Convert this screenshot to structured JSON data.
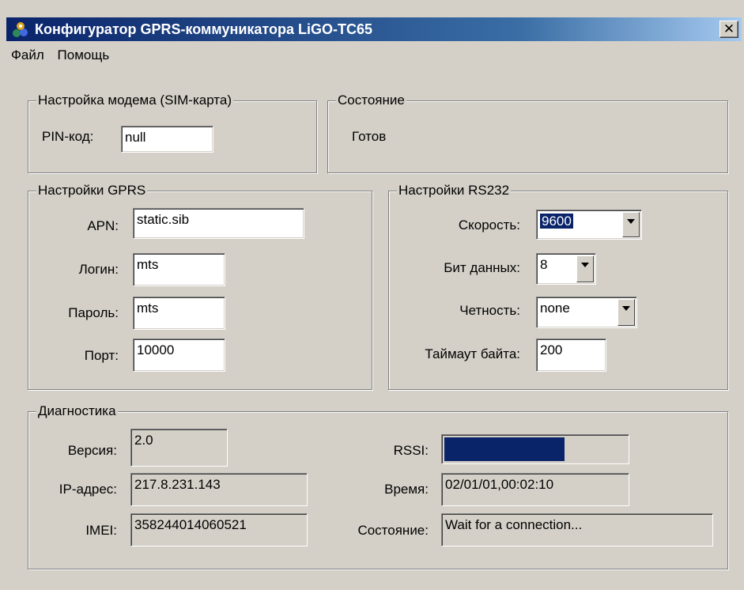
{
  "window": {
    "title": "Конфигуратор GPRS-коммуникатора LiGO-TC65",
    "close_label": "✕"
  },
  "menu": [
    "Файл",
    "Помощь"
  ],
  "modem": {
    "group_label": "Настройка модема (SIM-карта)",
    "pin_label": "PIN-код:",
    "pin_value": "null"
  },
  "status": {
    "group_label": "Состояние",
    "text": "Готов"
  },
  "gprs": {
    "group_label": "Настройки GPRS",
    "apn_label": "APN:",
    "apn_value": "static.sib",
    "login_label": "Логин:",
    "login_value": "mts",
    "password_label": "Пароль:",
    "password_value": "mts",
    "port_label": "Порт:",
    "port_value": "10000"
  },
  "rs232": {
    "group_label": "Настройки RS232",
    "speed_label": "Скорость:",
    "speed_value": "9600",
    "databits_label": "Бит данных:",
    "databits_value": "8",
    "parity_label": "Четность:",
    "parity_value": "none",
    "timeout_label": "Таймаут байта:",
    "timeout_value": "200"
  },
  "diag": {
    "group_label": "Диагностика",
    "version_label": "Версия:",
    "version_value": "2.0",
    "ip_label": "IP-адрес:",
    "ip_value": "217.8.231.143",
    "imei_label": "IMEI:",
    "imei_value": "358244014060521",
    "rssi_label": "RSSI:",
    "rssi_fraction": 0.66,
    "time_label": "Время:",
    "time_value": "02/01/01,00:02:10",
    "state_label": "Состояние:",
    "state_value": "Wait for a connection..."
  },
  "colors": {
    "face": "#d4d0c8",
    "title_active": "#0a246a",
    "selection": "#0a246a"
  }
}
